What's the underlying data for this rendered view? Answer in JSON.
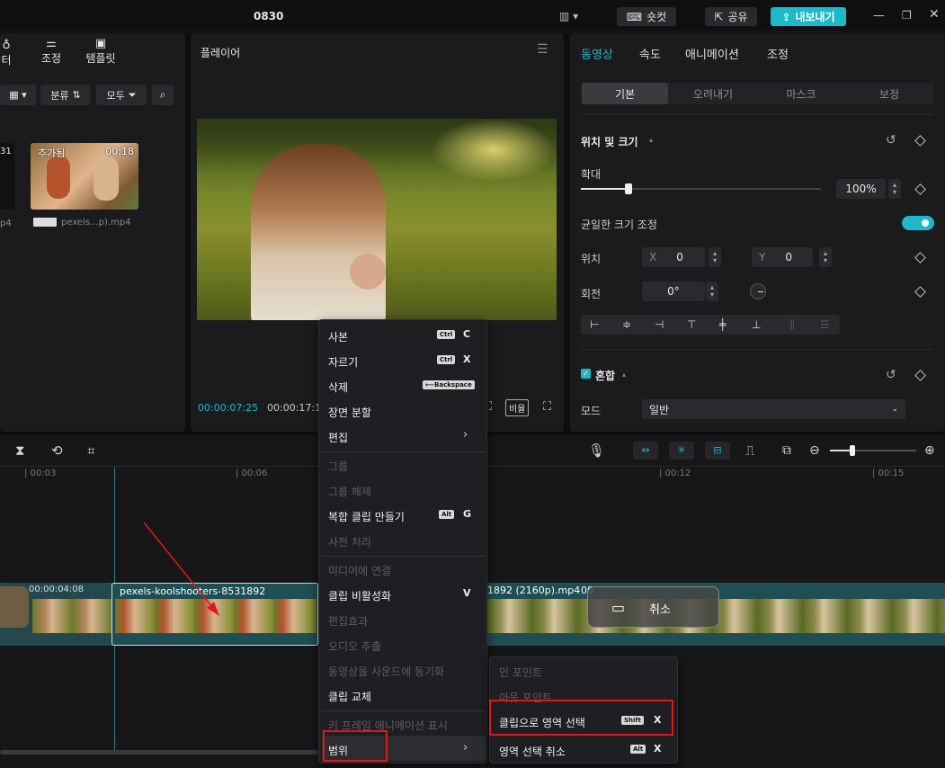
{
  "window": {
    "title": "0830"
  },
  "topbar": {
    "shortcut_label": "숏컷",
    "share_label": "공유",
    "export_label": "내보내기",
    "accent": "#1fb8c8"
  },
  "media": {
    "tabs": [
      {
        "label": "터"
      },
      {
        "label": "조정"
      },
      {
        "label": "템플릿"
      }
    ],
    "sort_label": "분류",
    "filter_label": "모두",
    "clip_left_duration": "31",
    "clip_left_name": "p4",
    "clip": {
      "badge": "추가됨",
      "duration": "00:18",
      "name": "pexels...p).mp4"
    }
  },
  "player": {
    "title": "플레이어",
    "current_time": "00:00:07:25",
    "total_time": "00:00:17:1",
    "ratio_label": "비율"
  },
  "inspector": {
    "tabs": [
      "동영상",
      "속도",
      "애니메이션",
      "조정"
    ],
    "subtabs": [
      "기본",
      "오려내기",
      "마스크",
      "보정"
    ],
    "section_position": "위치 및 크기",
    "scale_label": "확대",
    "scale_value": "100%",
    "scale_level": 0.2,
    "uniform_label": "균일한 크기 조정",
    "position_label": "위치",
    "x_label": "X",
    "x_value": "0",
    "y_label": "Y",
    "y_value": "0",
    "rotation_label": "회전",
    "rotation_value": "0°",
    "section_blend": "혼합",
    "mode_label": "모드",
    "mode_value": "일반"
  },
  "timeline": {
    "ruler": [
      "| 00:03",
      "| 00:06",
      "| 00:12",
      "| 00:15"
    ],
    "clip_prev_time": "00:00:04:08",
    "clip_main_name": "pexels-koolshooters-8531892 (2160p).mp4",
    "clip_next_name": "1892 (2160p).mp4",
    "clip_next_prefix": "00",
    "cancel_label": "취소"
  },
  "context_menu": {
    "items": [
      {
        "label": "사본",
        "kbd": "Ctrl",
        "key": "C",
        "enabled": true
      },
      {
        "label": "자르기",
        "kbd": "Ctrl",
        "key": "X",
        "enabled": true
      },
      {
        "label": "삭제",
        "kbd": "⟵Backspace",
        "key": "",
        "enabled": true
      },
      {
        "label": "장면 분할",
        "enabled": true
      },
      {
        "label": "편집",
        "submenu": true,
        "enabled": true
      },
      {
        "label": "그룹",
        "enabled": false
      },
      {
        "label": "그룹 해제",
        "enabled": false
      },
      {
        "label": "복합 클립 만들기",
        "kbd": "Alt",
        "key": "G",
        "enabled": true
      },
      {
        "label": "사전 처리",
        "enabled": false
      },
      {
        "label": "미디어에 연결",
        "enabled": false
      },
      {
        "label": "클립 비활성화",
        "key": "V",
        "enabled": true
      },
      {
        "label": "편집효과",
        "enabled": false
      },
      {
        "label": "오디오 추출",
        "enabled": false
      },
      {
        "label": "동영상을 사운드에 동기화",
        "enabled": false
      },
      {
        "label": "클립 교체",
        "enabled": true
      },
      {
        "label": "키 프레임 애니메이션 표시",
        "enabled": false
      },
      {
        "label": "범위",
        "submenu": true,
        "enabled": true
      }
    ]
  },
  "submenu": {
    "items": [
      {
        "label": "인 포인트",
        "enabled": false
      },
      {
        "label": "아웃 포인트",
        "enabled": false
      },
      {
        "label": "클립으로 영역 선택",
        "kbd": "Shift",
        "key": "X",
        "enabled": true
      },
      {
        "label": "영역 선택 취소",
        "kbd": "Alt",
        "key": "X",
        "enabled": true
      }
    ]
  },
  "annotation": {
    "highlight_color": "#e01818"
  }
}
